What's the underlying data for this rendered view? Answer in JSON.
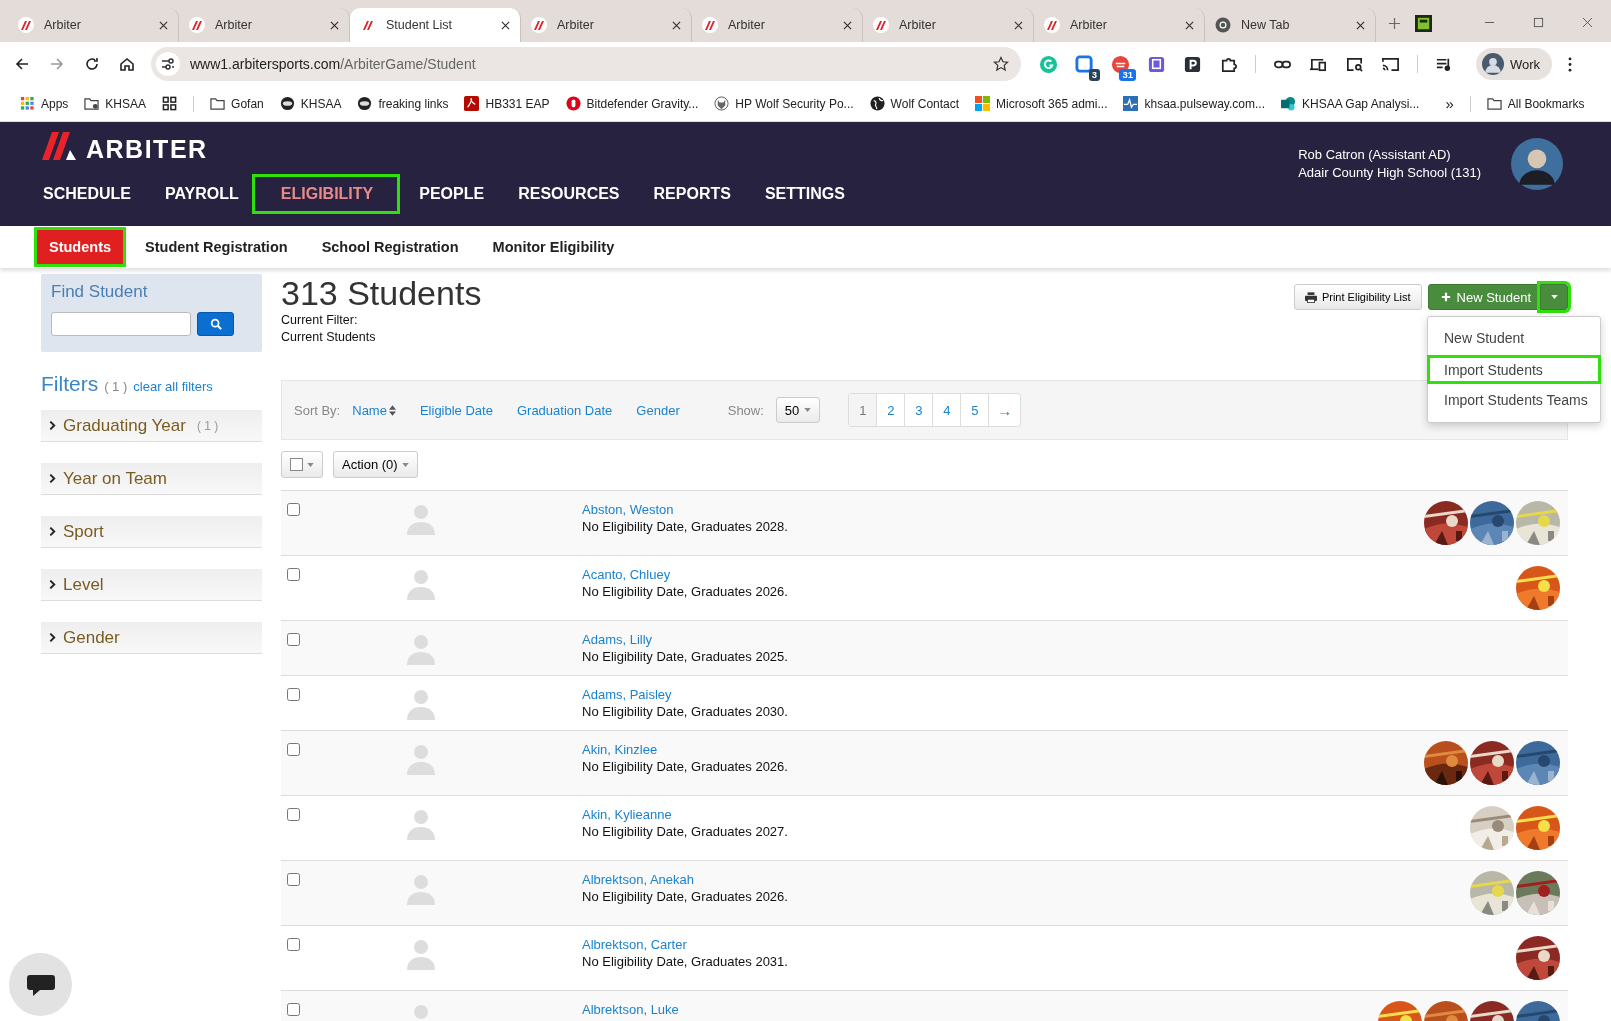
{
  "browser": {
    "tabs": [
      {
        "title": "Arbiter",
        "kind": "arbiter",
        "selected": false
      },
      {
        "title": "Arbiter",
        "kind": "arbiter",
        "selected": false
      },
      {
        "title": "Student List",
        "kind": "arbiter",
        "selected": true
      },
      {
        "title": "Arbiter",
        "kind": "arbiter",
        "selected": false
      },
      {
        "title": "Arbiter",
        "kind": "arbiter",
        "selected": false
      },
      {
        "title": "Arbiter",
        "kind": "arbiter",
        "selected": false
      },
      {
        "title": "Arbiter",
        "kind": "arbiter",
        "selected": false
      },
      {
        "title": "New Tab",
        "kind": "chrome",
        "selected": false
      }
    ],
    "url": {
      "host": "www1.arbitersports.com",
      "path": "/ArbiterGame/Student"
    },
    "extensions": [
      {
        "kind": "grammarly"
      },
      {
        "kind": "tasks",
        "badge": "3"
      },
      {
        "kind": "calendar",
        "badge": "31"
      },
      {
        "kind": "twitch"
      },
      {
        "kind": "parking"
      },
      {
        "kind": "puzzle"
      },
      {
        "kind": "link"
      },
      {
        "kind": "devices"
      },
      {
        "kind": "inspect"
      },
      {
        "kind": "cast"
      },
      {
        "kind": "media"
      }
    ],
    "profile": "Work",
    "bookmarks": [
      {
        "label": "Apps",
        "kind": "apps"
      },
      {
        "label": "KHSAA",
        "kind": "folder-gear"
      },
      {
        "kind": "grid"
      },
      {
        "label": "Gofan",
        "kind": "folder"
      },
      {
        "label": "KHSAA",
        "kind": "seal"
      },
      {
        "label": "freaking links",
        "kind": "seal"
      },
      {
        "label": "HB331 EAP",
        "kind": "pdf"
      },
      {
        "label": "Bitdefender Gravity...",
        "kind": "shield"
      },
      {
        "label": "HP Wolf Security Po...",
        "kind": "wolf"
      },
      {
        "label": "Wolf Contact",
        "kind": "globe"
      },
      {
        "label": "Microsoft 365 admi...",
        "kind": "windows"
      },
      {
        "label": "khsaa.pulseway.com...",
        "kind": "pulse"
      },
      {
        "label": "KHSAA Gap Analysi...",
        "kind": "sharepoint"
      }
    ],
    "more": "»",
    "all_bookmarks": "All Bookmarks"
  },
  "app": {
    "brand": "ARBITER",
    "user": "Rob Catron (Assistant AD)",
    "school": "Adair County High School (131)",
    "nav": [
      {
        "label": "SCHEDULE",
        "selected": false,
        "highlighted": false
      },
      {
        "label": "PAYROLL",
        "selected": false,
        "highlighted": false
      },
      {
        "label": "ELIGIBILITY",
        "selected": true,
        "highlighted": true
      },
      {
        "label": "PEOPLE",
        "selected": false,
        "highlighted": false
      },
      {
        "label": "RESOURCES",
        "selected": false,
        "highlighted": false
      },
      {
        "label": "REPORTS",
        "selected": false,
        "highlighted": false
      },
      {
        "label": "SETTINGS",
        "selected": false,
        "highlighted": false
      }
    ],
    "subnav": [
      {
        "label": "Students",
        "selected": true,
        "highlighted": true
      },
      {
        "label": "Student Registration",
        "selected": false,
        "highlighted": false
      },
      {
        "label": "School Registration",
        "selected": false,
        "highlighted": false
      },
      {
        "label": "Monitor Eligibility",
        "selected": false,
        "highlighted": false
      }
    ]
  },
  "find": {
    "title": "Find Student"
  },
  "filters": {
    "title": "Filters",
    "count": "( 1 )",
    "clear": "clear all filters",
    "groups": [
      {
        "label": "Graduating Year",
        "count": "( 1 )"
      },
      {
        "label": "Year on Team"
      },
      {
        "label": "Sport"
      },
      {
        "label": "Level"
      },
      {
        "label": "Gender"
      }
    ]
  },
  "heading": "313 Students",
  "filter_label": "Current Filter:",
  "filter_value": "Current Students",
  "actions": {
    "print": "Print Eligibility List",
    "new": "New Student",
    "caret_highlighted": true,
    "menu": [
      {
        "label": "New Student",
        "highlighted": false
      },
      {
        "label": "Import Students",
        "highlighted": true
      },
      {
        "label": "Import Students Teams",
        "highlighted": false
      }
    ]
  },
  "sort": {
    "label": "Sort By:",
    "options": [
      {
        "label": "Name",
        "selected": true
      },
      {
        "label": "Eligible Date",
        "selected": false
      },
      {
        "label": "Graduation Date",
        "selected": false
      },
      {
        "label": "Gender",
        "selected": false
      }
    ]
  },
  "show": {
    "label": "Show:",
    "value": "50"
  },
  "pages": [
    {
      "label": "1",
      "selected": true
    },
    {
      "label": "2",
      "selected": false
    },
    {
      "label": "3",
      "selected": false
    },
    {
      "label": "4",
      "selected": false
    },
    {
      "label": "5",
      "selected": false
    },
    {
      "label": "→",
      "selected": false
    }
  ],
  "bulk": {
    "action": "Action (0)"
  },
  "students": [
    {
      "name": "Abston, Weston",
      "detail": "No Eligibility Date, Graduates 2028.",
      "checked": false
    },
    {
      "name": "Acanto, Chluey",
      "detail": "No Eligibility Date, Graduates 2026.",
      "checked": false
    },
    {
      "name": "Adams, Lilly",
      "detail": "No Eligibility Date, Graduates 2025.",
      "checked": false
    },
    {
      "name": "Adams, Paisley",
      "detail": "No Eligibility Date, Graduates 2030.",
      "checked": false
    },
    {
      "name": "Akin, Kinzlee",
      "detail": "No Eligibility Date, Graduates 2026.",
      "checked": false
    },
    {
      "name": "Akin, Kylieanne",
      "detail": "No Eligibility Date, Graduates 2027.",
      "checked": false
    },
    {
      "name": "Albrektson, Anekah",
      "detail": "No Eligibility Date, Graduates 2026.",
      "checked": false
    },
    {
      "name": "Albrektson, Carter",
      "detail": "No Eligibility Date, Graduates 2031.",
      "checked": false
    },
    {
      "name": "Albrektson, Luke",
      "checked": false
    }
  ]
}
